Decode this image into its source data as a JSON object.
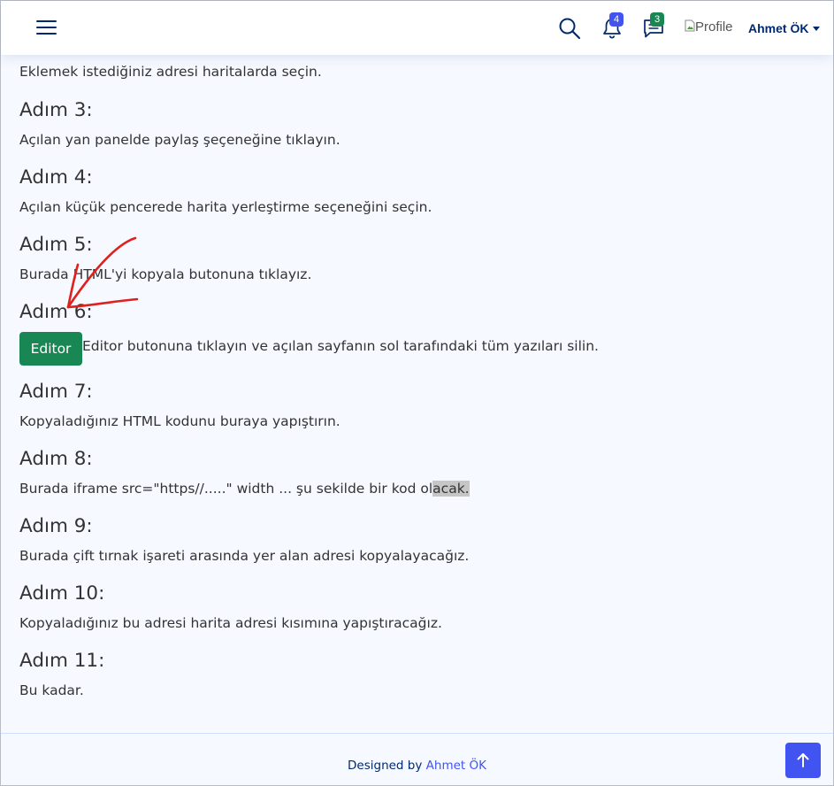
{
  "header": {
    "menu_icon": "hamburger-icon",
    "search_icon": "search-icon",
    "notifications_icon": "bell-icon",
    "notifications_count": "4",
    "messages_icon": "chat-icon",
    "messages_count": "3",
    "profile_image_alt": "Profile",
    "profile_name": "Ahmet ÖK",
    "colors": {
      "brand": "#012970",
      "primary": "#4154f1",
      "success": "#198754"
    }
  },
  "content": {
    "intro": "Eklemek istediğiniz adresi haritalarda seçin.",
    "steps": [
      {
        "title": "Adım 3:",
        "text": "Açılan yan panelde paylaş şeçeneğine tıklayın."
      },
      {
        "title": "Adım 4:",
        "text": "Açılan küçük pencerede harita yerleştirme seçeneğini seçin."
      },
      {
        "title": "Adım 5:",
        "text": "Burada HTML'yi kopyala butonuna tıklayız."
      },
      {
        "title": "Adım 6:",
        "button": "Editor",
        "text": "Editor butonuna tıklayın ve açılan sayfanın sol tarafındaki tüm yazıları silin."
      },
      {
        "title": "Adım 7:",
        "text": "Kopyaladığınız HTML kodunu buraya yapıştırın."
      },
      {
        "title": "Adım 8:",
        "text_before": "Burada iframe src=\"https//.....\" width ... şu sekilde bir kod ol",
        "text_highlight": "acak."
      },
      {
        "title": "Adım 9:",
        "text": "Burada çift tırnak işareti arasında yer alan adresi kopyalayacağız."
      },
      {
        "title": "Adım 10:",
        "text": "Kopyaladığınız bu adresi harita adresi kısımına yapıştıracağız."
      },
      {
        "title": "Adım 11:",
        "text": "Bu kadar."
      }
    ]
  },
  "annotation": {
    "arrow_color": "#e0201c"
  },
  "footer": {
    "prefix": "Designed by",
    "link": "Ahmet ÖK",
    "back_to_top_icon": "arrow-up-icon"
  }
}
